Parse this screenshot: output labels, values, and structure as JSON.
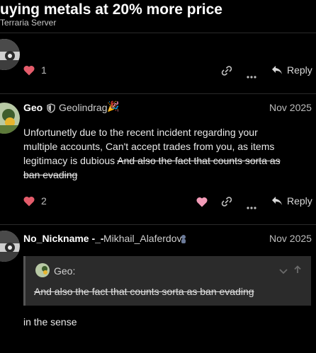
{
  "topic": {
    "title": "uying metals at 20% more price",
    "category": "Terraria Server"
  },
  "post1": {
    "like_count": "1",
    "reply_label": "Reply"
  },
  "post2": {
    "username": "Geo",
    "fullname": "Geolindrag",
    "flair_emoji": "🎉",
    "date": "Nov 2025",
    "body_text": "Unfortunetly due to the recent incident regarding your multiple accounts, Can't accept trades from you, as items legitimacy is dubious",
    "body_strike": "And also the fact that counts sorta as ban evading",
    "like_count": "2",
    "reply_label": "Reply"
  },
  "post3": {
    "username": "No_Nickname -_-",
    "fullname": "Mikhail_Alaferdov",
    "date": "Nov 2025",
    "quote_author": "Geo:",
    "quote_text": "And also the fact that counts sorta as ban evading",
    "body_text": "in the sense"
  },
  "colors": {
    "background": "#000000",
    "heart": "#e45c6b",
    "heart_pink": "#f29bb7",
    "quote_bg": "#2b2b2b"
  },
  "icons": [
    "heart-icon",
    "link-icon",
    "more-icon",
    "reply-icon",
    "shield-icon",
    "chevron-down-icon",
    "arrow-up-icon"
  ]
}
